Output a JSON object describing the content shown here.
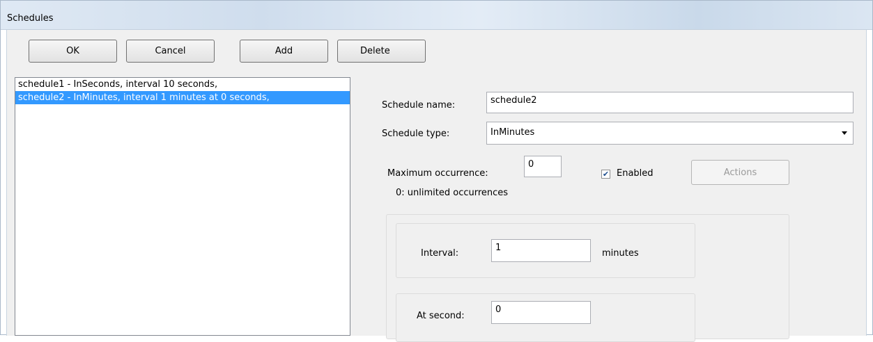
{
  "window": {
    "title": "Schedules"
  },
  "toolbar": {
    "ok_label": "OK",
    "cancel_label": "Cancel",
    "add_label": "Add",
    "delete_label": "Delete"
  },
  "schedules": {
    "items": [
      {
        "label": "schedule1 - InSeconds, interval 10 seconds,",
        "selected": false
      },
      {
        "label": "schedule2 - InMinutes, interval 1 minutes at 0 seconds,",
        "selected": true
      }
    ]
  },
  "details": {
    "name_label": "Schedule name:",
    "name_value": "schedule2",
    "type_label": "Schedule type:",
    "type_value": "InMinutes",
    "max_occ_label": "Maximum occurrence:",
    "max_occ_value": "0",
    "max_occ_hint": "0: unlimited occurrences",
    "enabled_label": "Enabled",
    "enabled_checked": true,
    "actions_label": "Actions",
    "interval_label": "Interval:",
    "interval_value": "1",
    "interval_unit": "minutes",
    "at_second_label": "At second:",
    "at_second_value": "0"
  },
  "colors": {
    "selection": "#3399ff",
    "dialog_bg": "#f0f0f0"
  }
}
